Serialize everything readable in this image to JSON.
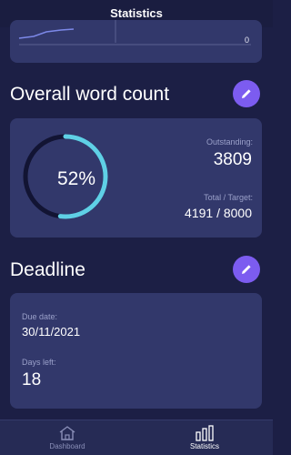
{
  "header": {
    "title": "Statistics"
  },
  "mini_chart": {
    "last_value": "0"
  },
  "word_count": {
    "title": "Overall word count",
    "percent": "52%",
    "progress_fraction": 0.52,
    "outstanding_label": "Outstanding:",
    "outstanding_value": "3809",
    "total_label": "Total / Target:",
    "total_value": "4191 / 8000"
  },
  "deadline": {
    "title": "Deadline",
    "due_label": "Due date:",
    "due_value": "30/11/2021",
    "days_label": "Days left:",
    "days_value": "18"
  },
  "tabs": [
    {
      "label": "Dashboard",
      "icon": "home-icon",
      "active": false
    },
    {
      "label": "Statistics",
      "icon": "bar-chart-icon",
      "active": true
    }
  ],
  "colors": {
    "background": "#1c1f45",
    "card": "#32386b",
    "accent": "#7c5cf0",
    "ring": "#5fd0e6",
    "ring_track": "#121433"
  }
}
